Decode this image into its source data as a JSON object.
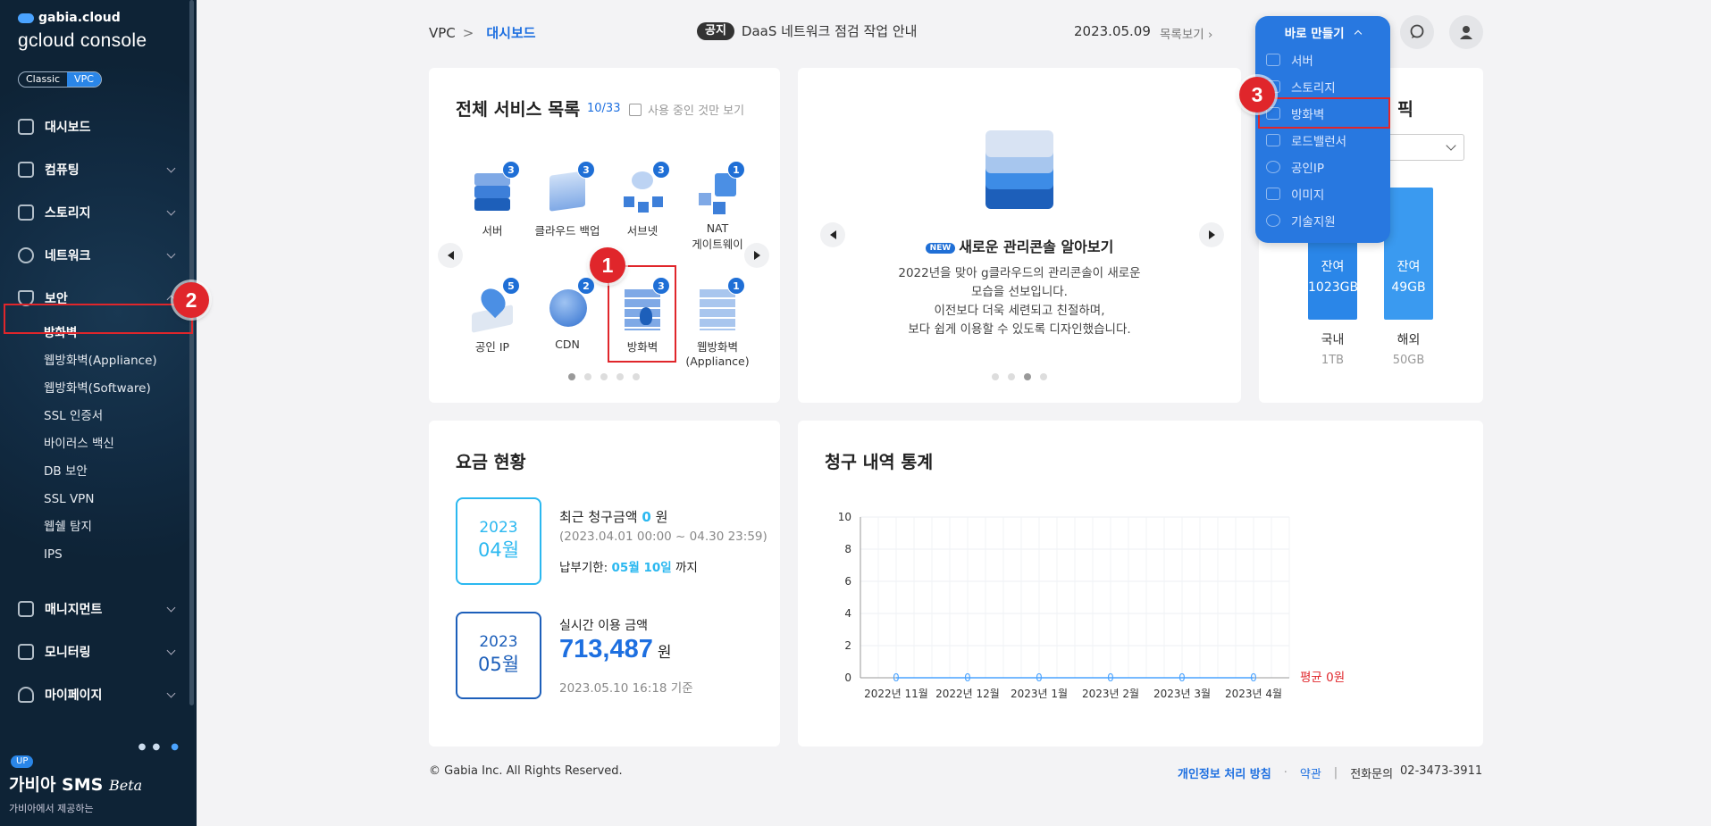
{
  "sidebar": {
    "brand_top": "gabia.cloud",
    "brand_main": "gcloud console",
    "mode": {
      "classic": "Classic",
      "vpc": "VPC"
    },
    "menu": {
      "dashboard": "대시보드",
      "computing": "컴퓨팅",
      "storage": "스토리지",
      "network": "네트워크",
      "security": "보안",
      "management": "매니지먼트",
      "monitoring": "모니터링",
      "mypage": "마이페이지"
    },
    "security_items": [
      "방화벽",
      "웹방화벽(Appliance)",
      "웹방화벽(Software)",
      "SSL 인증서",
      "바이러스 백신",
      "DB 보안",
      "SSL VPN",
      "웹쉘 탐지",
      "IPS"
    ],
    "sms": {
      "badge": "UP",
      "title": "가비아 SMS",
      "beta": "Beta",
      "sub": "가비아에서 제공하는"
    }
  },
  "topbar": {
    "crumb_root": "VPC",
    "crumb_sep": ">",
    "crumb_current": "대시보드",
    "notice_tag": "공지",
    "notice_text": "DaaS 네트워크 점검 작업 안내",
    "notice_date": "2023.05.09",
    "notice_more": "목록보기"
  },
  "quickmenu": {
    "title": "바로 만들기",
    "items": [
      "서버",
      "스토리지",
      "방화벽",
      "로드밸런서",
      "공인IP",
      "이미지",
      "기술지원"
    ]
  },
  "services": {
    "title": "전체 서비스 목록",
    "count": "10/33",
    "filter_label": "사용 중인 것만 보기",
    "items": [
      {
        "name": "서버",
        "count": "3"
      },
      {
        "name": "클라우드 백업",
        "count": "3"
      },
      {
        "name": "서브넷",
        "count": "3"
      },
      {
        "name": "NAT",
        "name2": "게이트웨이",
        "count": "1"
      },
      {
        "name": "공인 IP",
        "count": "5"
      },
      {
        "name": "CDN",
        "count": "2"
      },
      {
        "name": "방화벽",
        "count": "3"
      },
      {
        "name": "웹방화벽",
        "name2": "(Appliance)",
        "count": "1"
      }
    ]
  },
  "promo": {
    "new_tag": "NEW",
    "title": "새로운 관리콘솔 알아보기",
    "lines": [
      "2022년을 맞아 g클라우드의 관리콘솔이 새로운",
      "모습을 선보입니다.",
      "이전보다 더욱 세련되고 친절하며,",
      "보다 쉽게 이용할 수 있도록 디자인했습니다."
    ]
  },
  "traffic": {
    "title_tail": "픽",
    "bars": [
      {
        "label": "잔여",
        "value": "1023GB",
        "name": "국내",
        "total": "1TB"
      },
      {
        "label": "잔여",
        "value": "49GB",
        "name": "해외",
        "total": "50GB"
      }
    ]
  },
  "billing": {
    "title": "요금 현황",
    "recent": {
      "year": "2023",
      "month": "04월",
      "label": "최근 청구금액",
      "amount": "0",
      "unit": "원",
      "period": "(2023.04.01 00:00 ~ 04.30 23:59)",
      "due_label": "납부기한:",
      "due": "05월 10일",
      "due_tail": "까지"
    },
    "realtime": {
      "year": "2023",
      "month": "05월",
      "label": "실시간 이용 금액",
      "amount": "713,487",
      "unit": "원",
      "basis": "2023.05.10 16:18 기준"
    }
  },
  "chart_data": {
    "type": "line",
    "title": "청구 내역 통계",
    "categories": [
      "2022년 11월",
      "2022년 12월",
      "2023년 1월",
      "2023년 2월",
      "2023년 3월",
      "2023년 4월"
    ],
    "values": [
      0,
      0,
      0,
      0,
      0,
      0
    ],
    "ylim": [
      0,
      10
    ],
    "yticks": [
      0,
      2,
      4,
      6,
      8,
      10
    ],
    "grid": true,
    "average_label": "평균 0원",
    "colors": {
      "line": "#4aa3ff",
      "average": "#e0262b"
    }
  },
  "footer": {
    "copyright": "© Gabia Inc. All Rights Reserved.",
    "privacy": "개인정보 처리 방침",
    "dot": "·",
    "terms": "약관",
    "bar": "|",
    "contact_label": "전화문의",
    "contact": "02-3473-3911"
  },
  "markers": [
    "1",
    "2",
    "3"
  ],
  "colors": {
    "accent": "#1d6fe0",
    "sidebar_bg": "#0e2336",
    "highlight": "#e0262b"
  }
}
